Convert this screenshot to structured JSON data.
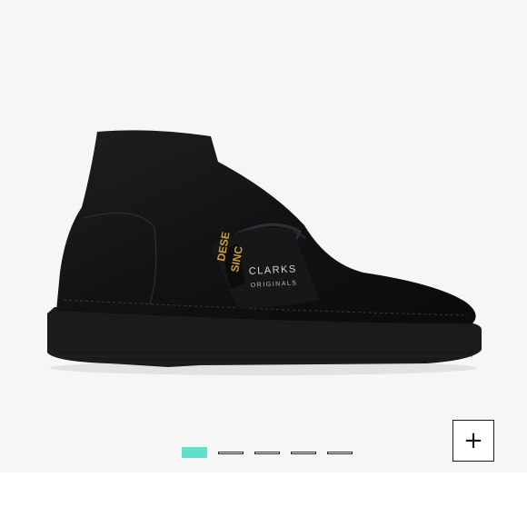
{
  "product": {
    "brand_tag_line1": "CLARKS",
    "brand_tag_line2": "ORIGINALS",
    "label_fragment_1": "DESE",
    "label_fragment_2": "SINC",
    "image_icon": "desert-boot-image"
  },
  "carousel": {
    "slide_count": 5,
    "active_index": 0,
    "accent_color": "#5fe0c9",
    "icons": [
      "slide-indicator",
      "slide-indicator",
      "slide-indicator",
      "slide-indicator",
      "slide-indicator"
    ]
  },
  "zoom": {
    "symbol": "+",
    "icon": "plus-icon"
  },
  "colors": {
    "viewer_bg": "#f6f6f7",
    "boot": "#111111",
    "sole": "#1b1b1b"
  }
}
